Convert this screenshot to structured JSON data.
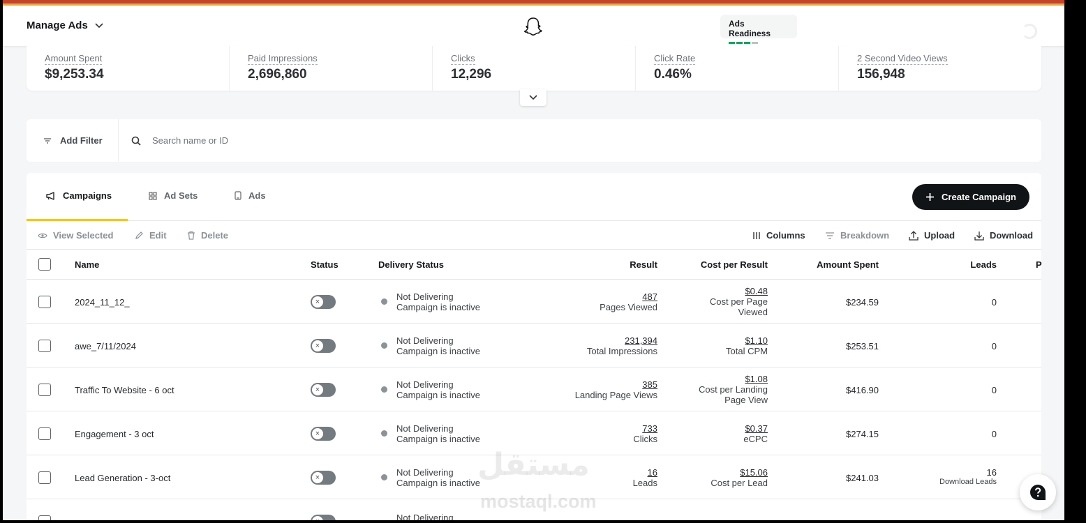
{
  "header": {
    "title": "Manage Ads",
    "ads_readiness": "Ads Readiness"
  },
  "metrics": [
    {
      "label": "Amount Spent",
      "value": "$9,253.34"
    },
    {
      "label": "Paid Impressions",
      "value": "2,696,860"
    },
    {
      "label": "Clicks",
      "value": "12,296"
    },
    {
      "label": "Click Rate",
      "value": "0.46%"
    },
    {
      "label": "2 Second Video Views",
      "value": "156,948"
    }
  ],
  "filter": {
    "add_filter": "Add Filter",
    "search_placeholder": "Search name or ID"
  },
  "tabs": [
    {
      "label": "Campaigns",
      "active": true
    },
    {
      "label": "Ad Sets",
      "active": false
    },
    {
      "label": "Ads",
      "active": false
    }
  ],
  "create_button": "Create Campaign",
  "toolbar": {
    "view_selected": "View Selected",
    "edit": "Edit",
    "delete": "Delete",
    "columns": "Columns",
    "breakdown": "Breakdown",
    "upload": "Upload",
    "download": "Download"
  },
  "table": {
    "columns": {
      "name": "Name",
      "status": "Status",
      "delivery": "Delivery Status",
      "result": "Result",
      "cost": "Cost per Result",
      "spent": "Amount Spent",
      "leads": "Leads",
      "next": "P"
    },
    "rows": [
      {
        "name": "2024_11_12_",
        "delivery_1": "Not Delivering",
        "delivery_2": "Campaign is inactive",
        "result": "487",
        "result_label": "Pages Viewed",
        "cost": "$0.48",
        "cost_label_1": "Cost per Page",
        "cost_label_2": "Viewed",
        "spent": "$234.59",
        "leads": "0",
        "leads_label": ""
      },
      {
        "name": "awe_7/11/2024",
        "delivery_1": "Not Delivering",
        "delivery_2": "Campaign is inactive",
        "result": "231,394",
        "result_label": "Total Impressions",
        "cost": "$1.10",
        "cost_label_1": "Total CPM",
        "cost_label_2": "",
        "spent": "$253.51",
        "leads": "0",
        "leads_label": ""
      },
      {
        "name": "Traffic To Website - 6 oct",
        "delivery_1": "Not Delivering",
        "delivery_2": "Campaign is inactive",
        "result": "385",
        "result_label": "Landing Page Views",
        "cost": "$1.08",
        "cost_label_1": "Cost per Landing",
        "cost_label_2": "Page View",
        "spent": "$416.90",
        "leads": "0",
        "leads_label": ""
      },
      {
        "name": "Engagement - 3 oct",
        "delivery_1": "Not Delivering",
        "delivery_2": "Campaign is inactive",
        "result": "733",
        "result_label": "Clicks",
        "cost": "$0.37",
        "cost_label_1": "eCPC",
        "cost_label_2": "",
        "spent": "$274.15",
        "leads": "0",
        "leads_label": ""
      },
      {
        "name": "Lead Generation - 3-oct",
        "delivery_1": "Not Delivering",
        "delivery_2": "Campaign is inactive",
        "result": "16",
        "result_label": "Leads",
        "cost": "$15.06",
        "cost_label_1": "Cost per Lead",
        "cost_label_2": "",
        "spent": "$241.03",
        "leads": "16",
        "leads_label": "Download Leads"
      },
      {
        "name": "",
        "delivery_1": "Not Delivering",
        "delivery_2": "",
        "result": "",
        "result_label": "",
        "cost": "",
        "cost_label_1": "",
        "cost_label_2": "",
        "spent": "",
        "leads": "",
        "leads_label": ""
      }
    ]
  },
  "watermark": {
    "arabic": "مستقل",
    "latin": "mostaql.com"
  },
  "colors": {
    "accent": "#f1c232",
    "primary_button": "#111417",
    "stripe": "#c4432b",
    "readiness_green": "#1aa05a"
  }
}
